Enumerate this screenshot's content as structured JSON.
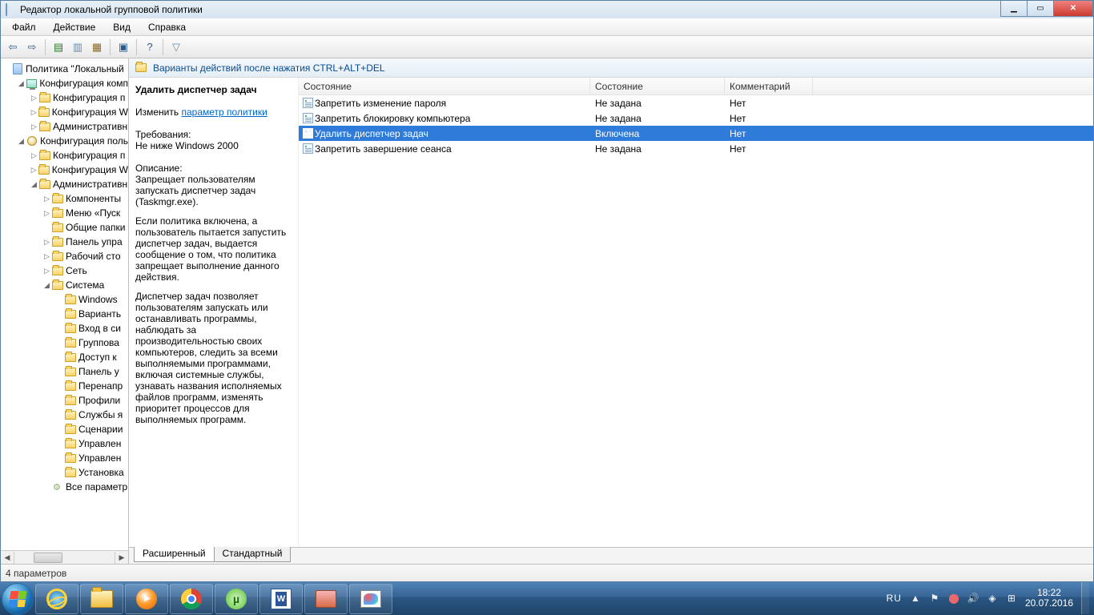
{
  "window": {
    "title": "Редактор локальной групповой политики"
  },
  "menu": {
    "file": "Файл",
    "action": "Действие",
    "view": "Вид",
    "help": "Справка"
  },
  "tree": {
    "root": "Политика \"Локальный",
    "items": [
      {
        "depth": 1,
        "ex": "◢",
        "icon": "comp",
        "label": "Конфигурация комп"
      },
      {
        "depth": 2,
        "ex": "▷",
        "icon": "folder",
        "label": "Конфигурация п"
      },
      {
        "depth": 2,
        "ex": "▷",
        "icon": "folder",
        "label": "Конфигурация W"
      },
      {
        "depth": 2,
        "ex": "▷",
        "icon": "folder",
        "label": "Административн"
      },
      {
        "depth": 1,
        "ex": "◢",
        "icon": "user",
        "label": "Конфигурация поль"
      },
      {
        "depth": 2,
        "ex": "▷",
        "icon": "folder",
        "label": "Конфигурация п"
      },
      {
        "depth": 2,
        "ex": "▷",
        "icon": "folder",
        "label": "Конфигурация W"
      },
      {
        "depth": 2,
        "ex": "◢",
        "icon": "folder",
        "label": "Административн"
      },
      {
        "depth": 3,
        "ex": "▷",
        "icon": "folder",
        "label": "Компоненты"
      },
      {
        "depth": 3,
        "ex": "▷",
        "icon": "folder",
        "label": "Меню «Пуск"
      },
      {
        "depth": 3,
        "ex": "",
        "icon": "folder",
        "label": "Общие папки"
      },
      {
        "depth": 3,
        "ex": "▷",
        "icon": "folder",
        "label": "Панель упра"
      },
      {
        "depth": 3,
        "ex": "▷",
        "icon": "folder",
        "label": "Рабочий сто"
      },
      {
        "depth": 3,
        "ex": "▷",
        "icon": "folder",
        "label": "Сеть"
      },
      {
        "depth": 3,
        "ex": "◢",
        "icon": "folder",
        "label": "Система"
      },
      {
        "depth": 4,
        "ex": "",
        "icon": "folder",
        "label": "Windows"
      },
      {
        "depth": 4,
        "ex": "",
        "icon": "folder",
        "label": "Варианть"
      },
      {
        "depth": 4,
        "ex": "",
        "icon": "folder",
        "label": "Вход в си"
      },
      {
        "depth": 4,
        "ex": "",
        "icon": "folder",
        "label": "Группова"
      },
      {
        "depth": 4,
        "ex": "",
        "icon": "folder",
        "label": "Доступ к"
      },
      {
        "depth": 4,
        "ex": "",
        "icon": "folder",
        "label": "Панель у"
      },
      {
        "depth": 4,
        "ex": "",
        "icon": "folder",
        "label": "Перенапр"
      },
      {
        "depth": 4,
        "ex": "",
        "icon": "folder",
        "label": "Профили"
      },
      {
        "depth": 4,
        "ex": "",
        "icon": "folder",
        "label": "Службы я"
      },
      {
        "depth": 4,
        "ex": "",
        "icon": "folder",
        "label": "Сценарии"
      },
      {
        "depth": 4,
        "ex": "",
        "icon": "folder",
        "label": "Управлен"
      },
      {
        "depth": 4,
        "ex": "",
        "icon": "folder",
        "label": "Управлен"
      },
      {
        "depth": 4,
        "ex": "",
        "icon": "folder",
        "label": "Установка"
      },
      {
        "depth": 3,
        "ex": "",
        "icon": "gear",
        "label": "Все параметр"
      }
    ]
  },
  "path": "Варианты действий после нажатия CTRL+ALT+DEL",
  "detail": {
    "title": "Удалить диспетчер задач",
    "edit_prefix": "Изменить ",
    "edit_link": "параметр политики",
    "req_label": "Требования:",
    "req_text": "Не ниже Windows 2000",
    "desc_label": "Описание:",
    "desc1": "Запрещает пользователям запускать диспетчер задач (Taskmgr.exe).",
    "desc2": "Если политика включена, а пользователь пытается запустить диспетчер задач, выдается сообщение о том, что политика запрещает выполнение данного действия.",
    "desc3": "Диспетчер задач позволяет пользователям запускать или останавливать программы, наблюдать за производительностью своих компьютеров, следить за всеми выполняемыми программами, включая системные службы, узнавать названия исполняемых файлов программ, изменять приоритет процессов для выполняемых программ."
  },
  "columns": {
    "name": "Состояние",
    "state": "Состояние",
    "comment": "Комментарий"
  },
  "col_widths": {
    "name": 364,
    "state": 168,
    "comment": 110
  },
  "rows": [
    {
      "name": "Запретить изменение пароля",
      "state": "Не задана",
      "comment": "Нет",
      "sel": false
    },
    {
      "name": "Запретить блокировку компьютера",
      "state": "Не задана",
      "comment": "Нет",
      "sel": false
    },
    {
      "name": "Удалить диспетчер задач",
      "state": "Включена",
      "comment": "Нет",
      "sel": true
    },
    {
      "name": "Запретить завершение сеанса",
      "state": "Не задана",
      "comment": "Нет",
      "sel": false
    }
  ],
  "tabs": {
    "extended": "Расширенный",
    "standard": "Стандартный"
  },
  "status": "4 параметров",
  "systray": {
    "lang": "RU",
    "time": "18:22",
    "date": "20.07.2016"
  }
}
